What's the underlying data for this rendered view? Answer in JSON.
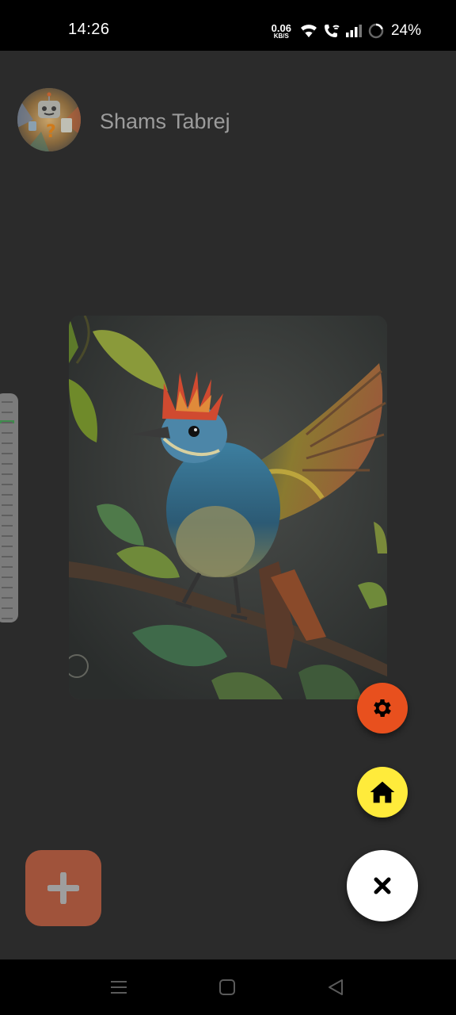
{
  "status_bar": {
    "time": "14:26",
    "net_speed_value": "0.06",
    "net_speed_unit": "KB/S",
    "battery_percent": "24%",
    "icons": [
      "wifi-icon",
      "wifi-call-icon",
      "signal-icon",
      "battery-ring-icon"
    ]
  },
  "profile": {
    "name": "Shams Tabrej",
    "avatar_icon": "robot-avatar"
  },
  "carousel": {
    "current_image": "bird-on-branch",
    "previous_image": "document-page"
  },
  "fab_menu": {
    "settings_icon": "gear-icon",
    "settings_color": "#e8501e",
    "home_icon": "home-icon",
    "home_color": "#ffeb3b",
    "close_icon": "close-icon",
    "close_color": "#ffffff"
  },
  "add_button": {
    "icon": "plus-icon",
    "color": "#a0533b"
  },
  "nav_bar": {
    "buttons": [
      "menu-icon",
      "home-square-icon",
      "back-triangle-icon"
    ]
  },
  "colors": {
    "background": "#2b2b2b",
    "name_text": "#9c9c9c"
  }
}
